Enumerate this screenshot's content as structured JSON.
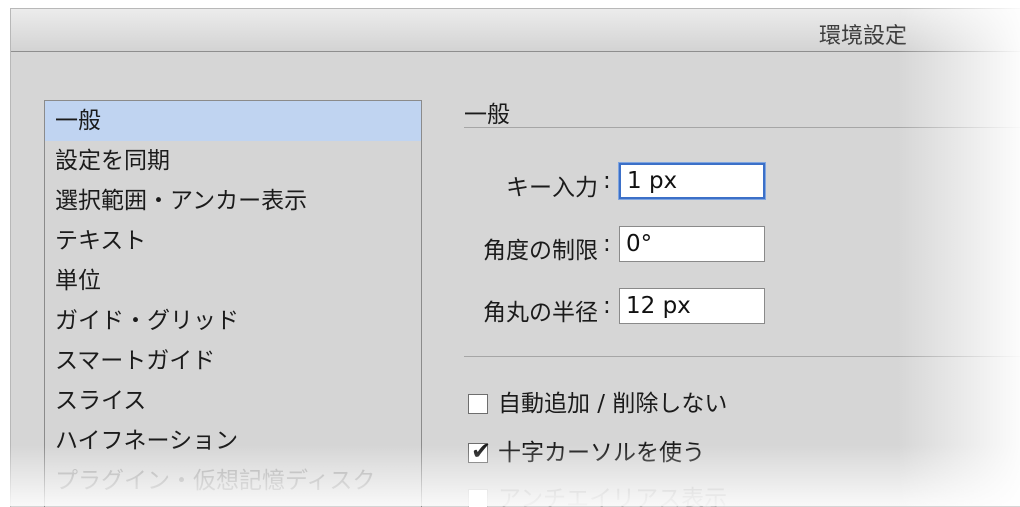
{
  "window": {
    "title": "環境設定"
  },
  "categories": [
    {
      "label": "一般",
      "selected": true
    },
    {
      "label": "設定を同期",
      "selected": false
    },
    {
      "label": "選択範囲・アンカー表示",
      "selected": false
    },
    {
      "label": "テキスト",
      "selected": false
    },
    {
      "label": "単位",
      "selected": false
    },
    {
      "label": "ガイド・グリッド",
      "selected": false
    },
    {
      "label": "スマートガイド",
      "selected": false
    },
    {
      "label": "スライス",
      "selected": false
    },
    {
      "label": "ハイフネーション",
      "selected": false
    },
    {
      "label": "プラグイン・仮想記憶ディスク",
      "selected": false
    }
  ],
  "general": {
    "section_title": "一般",
    "fields": [
      {
        "label": "キー入力",
        "colon": ":",
        "value": "1 px"
      },
      {
        "label": "角度の制限",
        "colon": ":",
        "value": "0°"
      },
      {
        "label": "角丸の半径",
        "colon": ":",
        "value": "12 px"
      }
    ],
    "checkboxes": [
      {
        "label": "自動追加 / 削除しない",
        "checked": false
      },
      {
        "label": "十字カーソルを使う",
        "checked": true
      },
      {
        "label": "アンチエイリアス表示",
        "checked": false
      }
    ]
  },
  "icons": {
    "check": "✔"
  },
  "colors": {
    "selection": "#c0d4f1",
    "focus_ring": "#3c70c8",
    "window_bg": "#d6d6d6"
  }
}
